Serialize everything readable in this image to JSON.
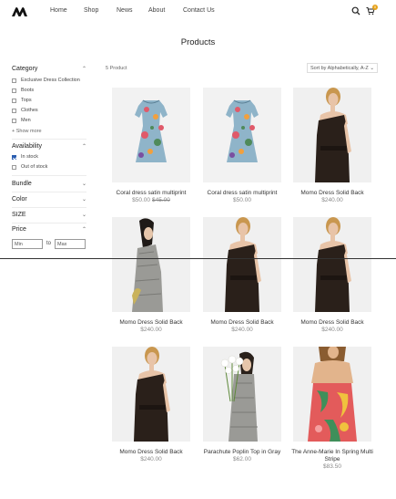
{
  "nav": {
    "items": [
      "Home",
      "Shop",
      "News",
      "About",
      "Contact Us"
    ]
  },
  "header": {
    "cart_count": "0",
    "icons": [
      "search-icon",
      "cart-icon"
    ]
  },
  "page": {
    "title": "Products"
  },
  "filters": {
    "category": {
      "title": "Category",
      "options": [
        "Exclusive Dress Collection",
        "Boots",
        "Tops",
        "Clothes",
        "Men"
      ],
      "show_more": "+ Show more"
    },
    "availability": {
      "title": "Availability",
      "options": [
        {
          "label": "In stock",
          "checked": true
        },
        {
          "label": "Out of stock",
          "checked": false
        }
      ]
    },
    "bundle": {
      "title": "Bundle"
    },
    "color": {
      "title": "Color"
    },
    "size": {
      "title": "SIZE"
    },
    "price": {
      "title": "Price",
      "min_placeholder": "Min",
      "to": "to",
      "max_placeholder": "Max"
    }
  },
  "toolbar": {
    "count": "5 Product",
    "sort": "Sort by Alphabetically, A-Z"
  },
  "products": [
    {
      "name": "Coral dress satin multiprint",
      "price": "$50.00",
      "compare_price": "$45.00",
      "image": "floral-dress"
    },
    {
      "name": "Coral dress satin multiprint",
      "price": "$50.00",
      "compare_price": "",
      "image": "floral-dress"
    },
    {
      "name": "Momo Dress Solid Back",
      "price": "$240.00",
      "compare_price": "",
      "image": "black-dress"
    },
    {
      "name": "Momo Dress Solid Back",
      "price": "$240.00",
      "compare_price": "",
      "image": "gray-coat"
    },
    {
      "name": "Momo Dress Solid Back",
      "price": "$240.00",
      "compare_price": "",
      "image": "black-dress"
    },
    {
      "name": "Momo Dress Solid Back",
      "price": "$240.00",
      "compare_price": "",
      "image": "black-dress"
    },
    {
      "name": "Momo Dress Solid Back",
      "price": "$240.00",
      "compare_price": "",
      "image": "black-dress"
    },
    {
      "name": "Parachute Poplin Top in Gray",
      "price": "$62.00",
      "compare_price": "",
      "image": "gray-flowers"
    },
    {
      "name": "The Anne-Marie In Spring Multi Stripe",
      "price": "$83.50",
      "compare_price": "",
      "image": "multi-stripe"
    }
  ],
  "colors": {
    "accent": "#e6a21a",
    "checkbox": "#2a5db0",
    "image_bg": "#f0f0f0"
  }
}
